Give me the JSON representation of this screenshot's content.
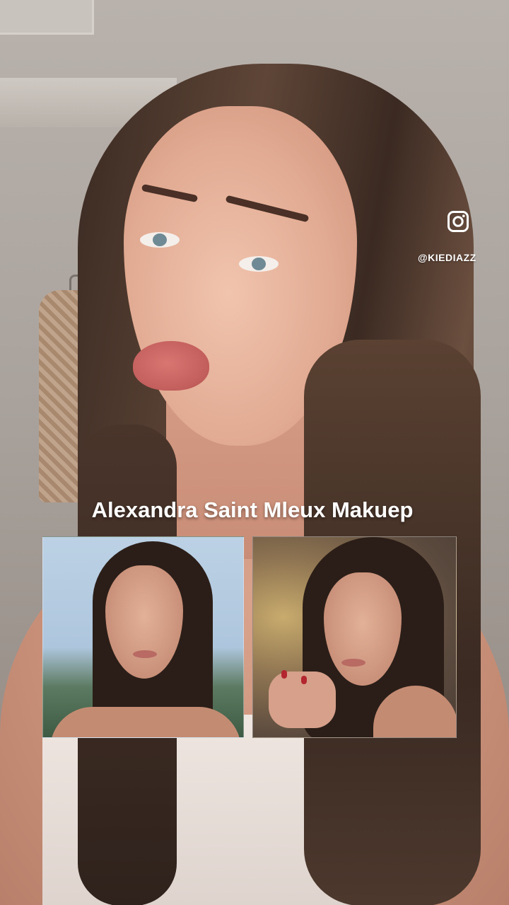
{
  "overlay": {
    "social_icon": "instagram-icon",
    "handle": "@KIEDIAZZ",
    "caption": "Alexandra Saint Mleux Makuep"
  },
  "references": [
    {
      "name": "reference-photo-1"
    },
    {
      "name": "reference-photo-2"
    }
  ],
  "colors": {
    "caption_text": "#ffffff",
    "handle_text": "#ffffff"
  }
}
